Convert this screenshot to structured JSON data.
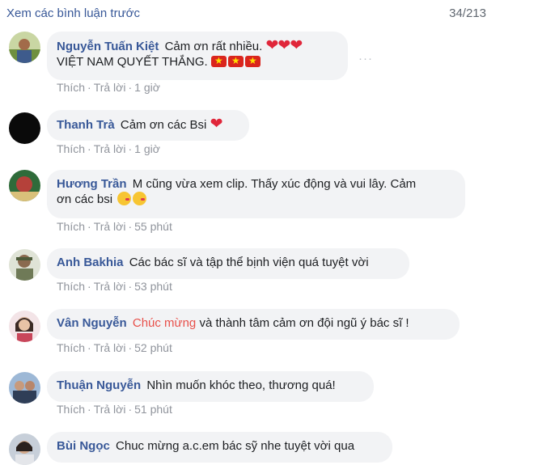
{
  "header": {
    "view_previous": "Xem các bình luận trước",
    "count": "34/213"
  },
  "actions": {
    "like": "Thích",
    "reply": "Trả lời",
    "sep": "·"
  },
  "comments": [
    {
      "author": "Nguyễn Tuấn Kiệt",
      "text": "Cảm ơn rất nhiều.",
      "line2": "VIỆT NAM QUYẾT THẮNG.",
      "hearts": "❤❤❤",
      "flag_star": "★",
      "more": "···",
      "time": "1 giờ"
    },
    {
      "author": "Thanh Trà",
      "text": "Cảm ơn các Bsi",
      "hearts": "❤",
      "time": "1 giờ"
    },
    {
      "author": "Hương Trần",
      "text": "M cũng vừa xem clip. Thấy xúc động và vui lây. Cảm",
      "line2": "ơn các bsi",
      "time": "55 phút"
    },
    {
      "author": "Anh Bakhia",
      "text": "Các bác sĩ và tập thể bịnh viện quá tuyệt vời",
      "time": "53 phút"
    },
    {
      "author": "Vân Nguyễn",
      "mention": "Chúc mừng",
      "text": "và thành tâm cảm ơn đội ngũ ý bác sĩ !",
      "time": "52 phút"
    },
    {
      "author": "Thuận Nguyễn",
      "text": "Nhìn muốn khóc theo, thương quá!",
      "time": "51 phút"
    },
    {
      "author": "Bùi Ngọc",
      "text": "Chuc mừng a.c.em bác sỹ nhe tuyệt vời qua"
    }
  ]
}
